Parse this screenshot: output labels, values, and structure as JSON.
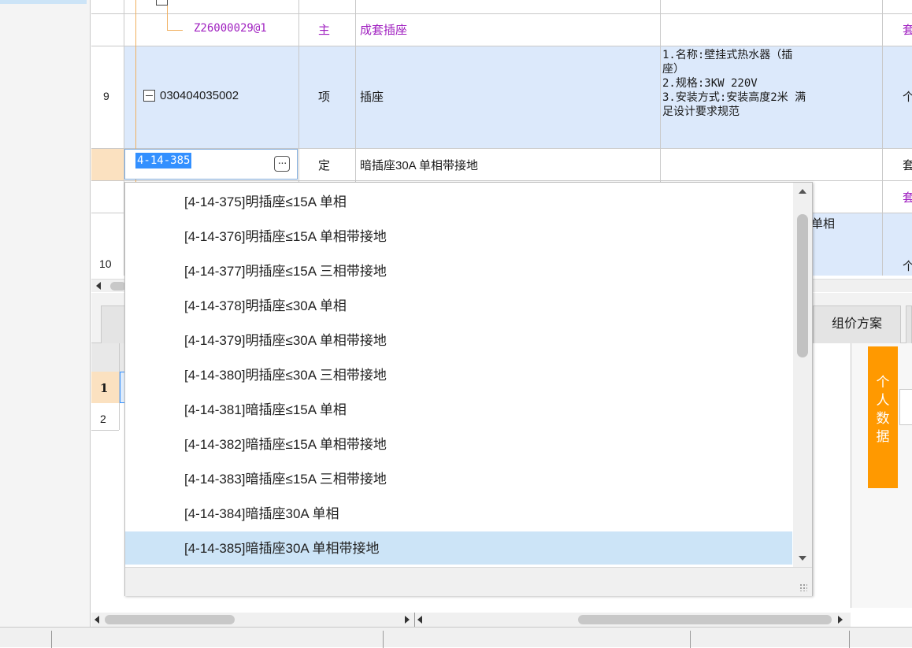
{
  "rows": {
    "r8_child_code": "Z26000029@1",
    "r8_child_type": "主",
    "r8_child_name": "成套插座",
    "r8_child_unit": "套",
    "r9_no": "9",
    "r9_code": "030404035002",
    "r9_type": "项",
    "r9_name": "插座",
    "r9_features": [
      "1.名称:壁挂式热水器（插",
      "座）",
      "2.规格:3KW 220V",
      "3.安装方式:安装高度2米 满",
      "足设计要求规范"
    ],
    "r9_unit": "个",
    "edit_code": "4-14-385",
    "edit_type": "定",
    "edit_name": "暗插座30A 单相带接地",
    "edit_unit": "套",
    "r10_no": "10",
    "r10_unit": "个",
    "r_hidden_unit": "套",
    "r10_partial_feature": "单相"
  },
  "dropdown": {
    "items": [
      "[4-14-375]明插座≤15A 单相",
      "[4-14-376]明插座≤15A 单相带接地",
      "[4-14-377]明插座≤15A 三相带接地",
      "[4-14-378]明插座≤30A 单相",
      "[4-14-379]明插座≤30A 单相带接地",
      "[4-14-380]明插座≤30A 三相带接地",
      "[4-14-381]暗插座≤15A 单相",
      "[4-14-382]暗插座≤15A 单相带接地",
      "[4-14-383]暗插座≤15A 三相带接地",
      "[4-14-384]暗插座30A 单相",
      "[4-14-385]暗插座30A 单相带接地"
    ],
    "selected_index": 10
  },
  "bottom": {
    "tab_group_price": "组价方案",
    "side_tab": [
      "个",
      "人",
      "数",
      "据"
    ],
    "grid_rows": [
      "1",
      "2"
    ]
  },
  "colors": {
    "accent_orange": "#ff9900",
    "selected_blue": "#cce4f7",
    "row_highlight": "#dce9fb",
    "child_purple": "#a020c0",
    "tree_line": "#f0b060"
  }
}
